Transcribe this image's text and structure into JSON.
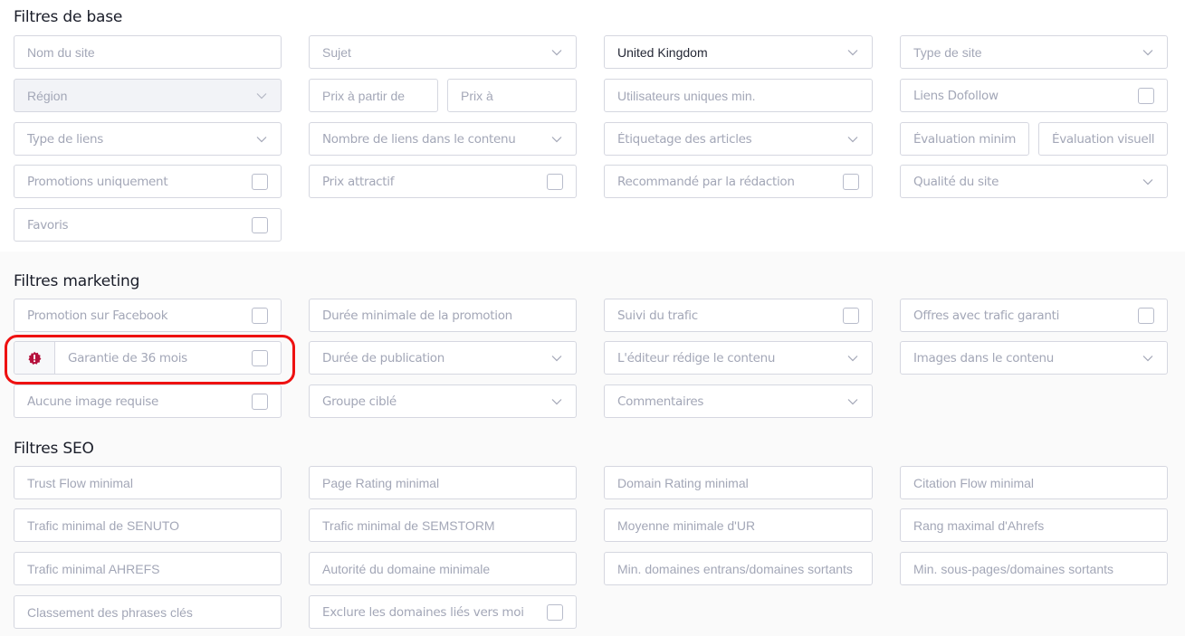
{
  "sections": {
    "base": {
      "title": "Filtres de base",
      "fields": {
        "site_name": {
          "placeholder": "Nom du site",
          "type": "text"
        },
        "subject": {
          "placeholder": "Sujet",
          "type": "select"
        },
        "country": {
          "value": "United Kingdom",
          "type": "select"
        },
        "site_type": {
          "placeholder": "Type de site",
          "type": "select"
        },
        "region": {
          "placeholder": "Région",
          "type": "select",
          "disabled": true
        },
        "price_from": {
          "placeholder": "Prix à partir de",
          "type": "text"
        },
        "price_to": {
          "placeholder": "Prix à",
          "type": "text"
        },
        "unique_users_min": {
          "placeholder": "Utilisateurs uniques min.",
          "type": "text"
        },
        "dofollow_links": {
          "label": "Liens Dofollow",
          "type": "checkbox",
          "checked": false
        },
        "link_type": {
          "placeholder": "Type de liens",
          "type": "select"
        },
        "links_in_content": {
          "placeholder": "Nombre de liens dans le contenu",
          "type": "select"
        },
        "article_tagging": {
          "placeholder": "Étiquetage des articles",
          "type": "select"
        },
        "min_rating": {
          "placeholder": "Évaluation minimale",
          "type": "text"
        },
        "visual_rating": {
          "placeholder": "Évaluation visuelle",
          "type": "text"
        },
        "promotions_only": {
          "label": "Promotions uniquement",
          "type": "checkbox",
          "checked": false
        },
        "attractive_price": {
          "label": "Prix attractif",
          "type": "checkbox",
          "checked": false
        },
        "editor_recommended": {
          "label": "Recommandé par la rédaction",
          "type": "checkbox",
          "checked": false
        },
        "site_quality": {
          "placeholder": "Qualité du site",
          "type": "select"
        },
        "favorites": {
          "label": "Favoris",
          "type": "checkbox",
          "checked": false
        }
      }
    },
    "marketing": {
      "title": "Filtres marketing",
      "fields": {
        "facebook_promotion": {
          "label": "Promotion sur Facebook",
          "type": "checkbox",
          "checked": false
        },
        "min_promotion_duration": {
          "placeholder": "Durée minimale de la promotion",
          "type": "text"
        },
        "traffic_tracking": {
          "label": "Suivi du trafic",
          "type": "checkbox",
          "checked": false
        },
        "guaranteed_traffic_offers": {
          "label": "Offres avec trafic garanti",
          "type": "checkbox",
          "checked": false
        },
        "guarantee_36_months": {
          "label": "Garantie de 36 mois",
          "type": "checkbox",
          "checked": false,
          "badge_icon": "alert-badge-icon",
          "badge_color": "#b5103c",
          "highlighted": true
        },
        "publication_duration": {
          "placeholder": "Durée de publication",
          "type": "select"
        },
        "publisher_writes_content": {
          "placeholder": "L'éditeur rédige le contenu",
          "type": "select"
        },
        "images_in_content": {
          "placeholder": "Images dans le contenu",
          "type": "select"
        },
        "no_image_required": {
          "label": "Aucune image requise",
          "type": "checkbox",
          "checked": false
        },
        "target_group": {
          "placeholder": "Groupe ciblé",
          "type": "select"
        },
        "comments": {
          "placeholder": "Commentaires",
          "type": "select"
        }
      }
    },
    "seo": {
      "title": "Filtres SEO",
      "fields": {
        "trust_flow_min": {
          "placeholder": "Trust Flow minimal",
          "type": "text"
        },
        "page_rating_min": {
          "placeholder": "Page Rating minimal",
          "type": "text"
        },
        "domain_rating_min": {
          "placeholder": "Domain Rating minimal",
          "type": "text"
        },
        "citation_flow_min": {
          "placeholder": "Citation Flow minimal",
          "type": "text"
        },
        "senuto_traffic_min": {
          "placeholder": "Trafic minimal de SENUTO",
          "type": "text"
        },
        "semstorm_traffic_min": {
          "placeholder": "Trafic minimal de SEMSTORM",
          "type": "text"
        },
        "ur_average_min": {
          "placeholder": "Moyenne minimale d'UR",
          "type": "text"
        },
        "ahrefs_rank_max": {
          "placeholder": "Rang maximal d'Ahrefs",
          "type": "text"
        },
        "ahrefs_traffic_min": {
          "placeholder": "Trafic minimal AHREFS",
          "type": "text"
        },
        "domain_authority_min": {
          "placeholder": "Autorité du domaine minimale",
          "type": "text"
        },
        "ref_domains_ratio_min": {
          "placeholder": "Min. domaines entrans/domaines sortants",
          "type": "text"
        },
        "subpages_ratio_min": {
          "placeholder": "Min. sous-pages/domaines sortants",
          "type": "text"
        },
        "keyword_ranking": {
          "placeholder": "Classement des phrases clés",
          "type": "text"
        },
        "exclude_linked_domains": {
          "label": "Exclure les domaines liés vers moi",
          "type": "checkbox",
          "checked": false
        }
      }
    }
  },
  "colors": {
    "highlight": "#ee1111",
    "border": "#d5d7e0",
    "placeholder": "#a3a7b7",
    "gray_section_bg": "#fafafa"
  }
}
